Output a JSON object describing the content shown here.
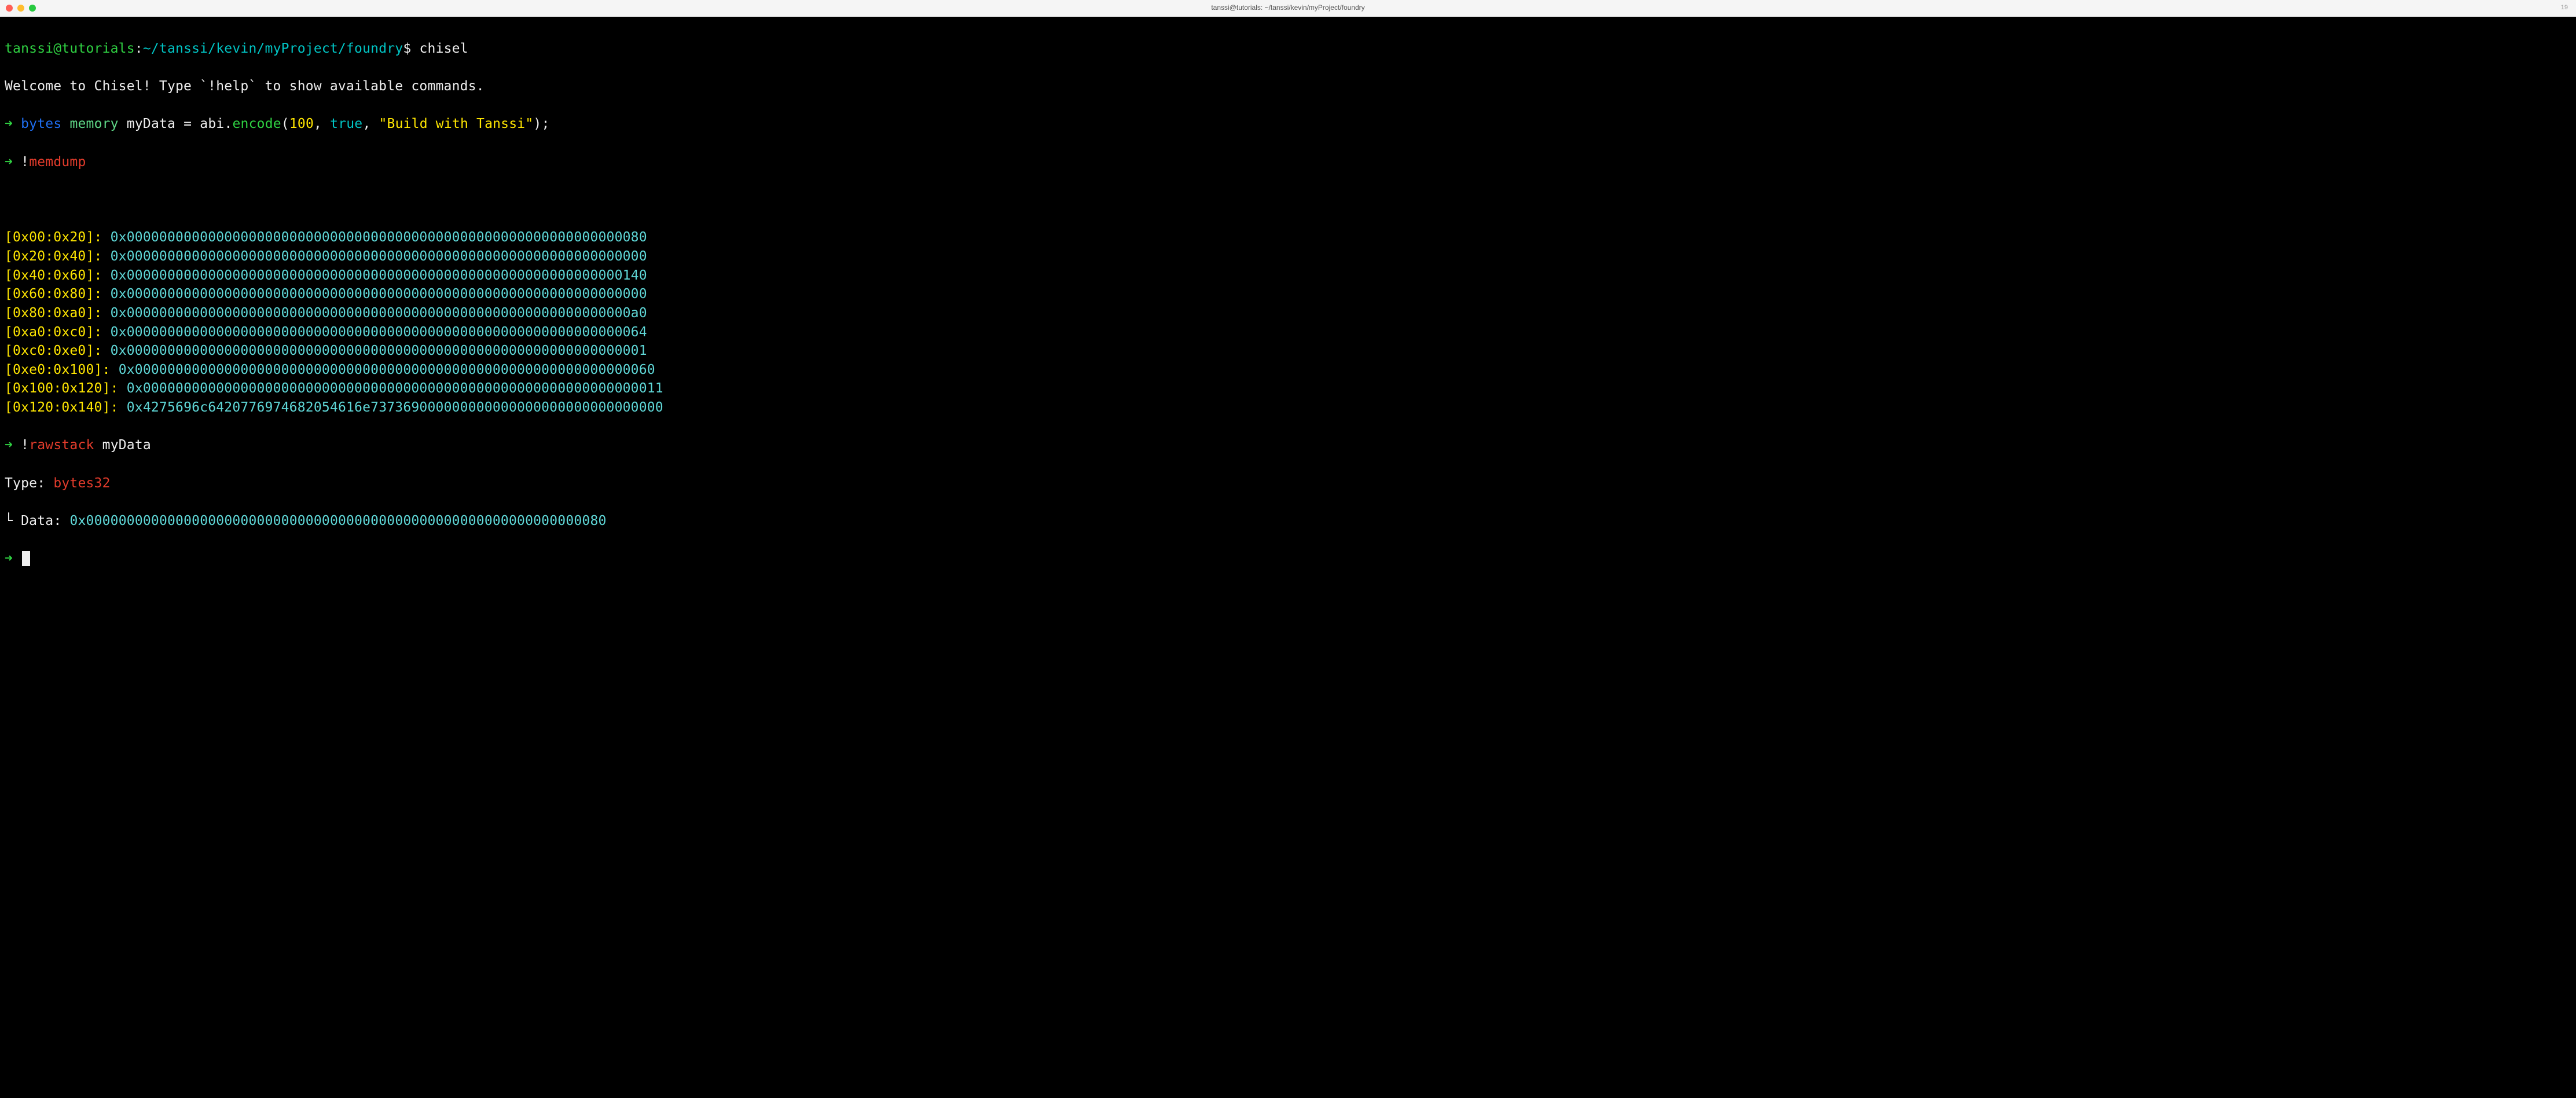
{
  "titlebar": {
    "window_title": "tanssi@tutorials: ~/tanssi/kevin/myProject/foundry",
    "badge": "19"
  },
  "prompt": {
    "user_host": "tanssi@tutorials",
    "sep0": ":",
    "cwd": "~/tanssi/kevin/myProject/foundry",
    "dollar": "$",
    "command": "chisel"
  },
  "welcome": "Welcome to Chisel! Type `!help` to show available commands.",
  "arrow": "➜",
  "line_bytes": {
    "kw_bytes": "bytes",
    "kw_memory": "memory",
    "var": "myData",
    "eq": "=",
    "abi": "abi",
    "dot": ".",
    "encode": "encode",
    "open": "(",
    "arg1": "100",
    "comma1": ",",
    "arg2": "true",
    "comma2": ",",
    "arg3": "\"Build with Tanssi\"",
    "close": ")",
    "semi": ";"
  },
  "memdump_cmd": {
    "bang": "!",
    "cmd": "memdump"
  },
  "memory_rows": [
    {
      "range": "[0x00:0x20]:",
      "value": "0x0000000000000000000000000000000000000000000000000000000000000080"
    },
    {
      "range": "[0x20:0x40]:",
      "value": "0x0000000000000000000000000000000000000000000000000000000000000000"
    },
    {
      "range": "[0x40:0x60]:",
      "value": "0x0000000000000000000000000000000000000000000000000000000000000140"
    },
    {
      "range": "[0x60:0x80]:",
      "value": "0x0000000000000000000000000000000000000000000000000000000000000000"
    },
    {
      "range": "[0x80:0xa0]:",
      "value": "0x00000000000000000000000000000000000000000000000000000000000000a0"
    },
    {
      "range": "[0xa0:0xc0]:",
      "value": "0x0000000000000000000000000000000000000000000000000000000000000064"
    },
    {
      "range": "[0xc0:0xe0]:",
      "value": "0x0000000000000000000000000000000000000000000000000000000000000001"
    },
    {
      "range": "[0xe0:0x100]:",
      "value": "0x0000000000000000000000000000000000000000000000000000000000000060"
    },
    {
      "range": "[0x100:0x120]:",
      "value": "0x0000000000000000000000000000000000000000000000000000000000000011"
    },
    {
      "range": "[0x120:0x140]:",
      "value": "0x4275696c6420776974682054616e737369000000000000000000000000000000"
    }
  ],
  "rawstack_cmd": {
    "bang": "!",
    "cmd": "rawstack",
    "arg": "myData"
  },
  "type_line": {
    "label": "Type:",
    "value": "bytes32"
  },
  "data_line": {
    "corner": "└",
    "label": "Data:",
    "value": "0x0000000000000000000000000000000000000000000000000000000000000080"
  }
}
